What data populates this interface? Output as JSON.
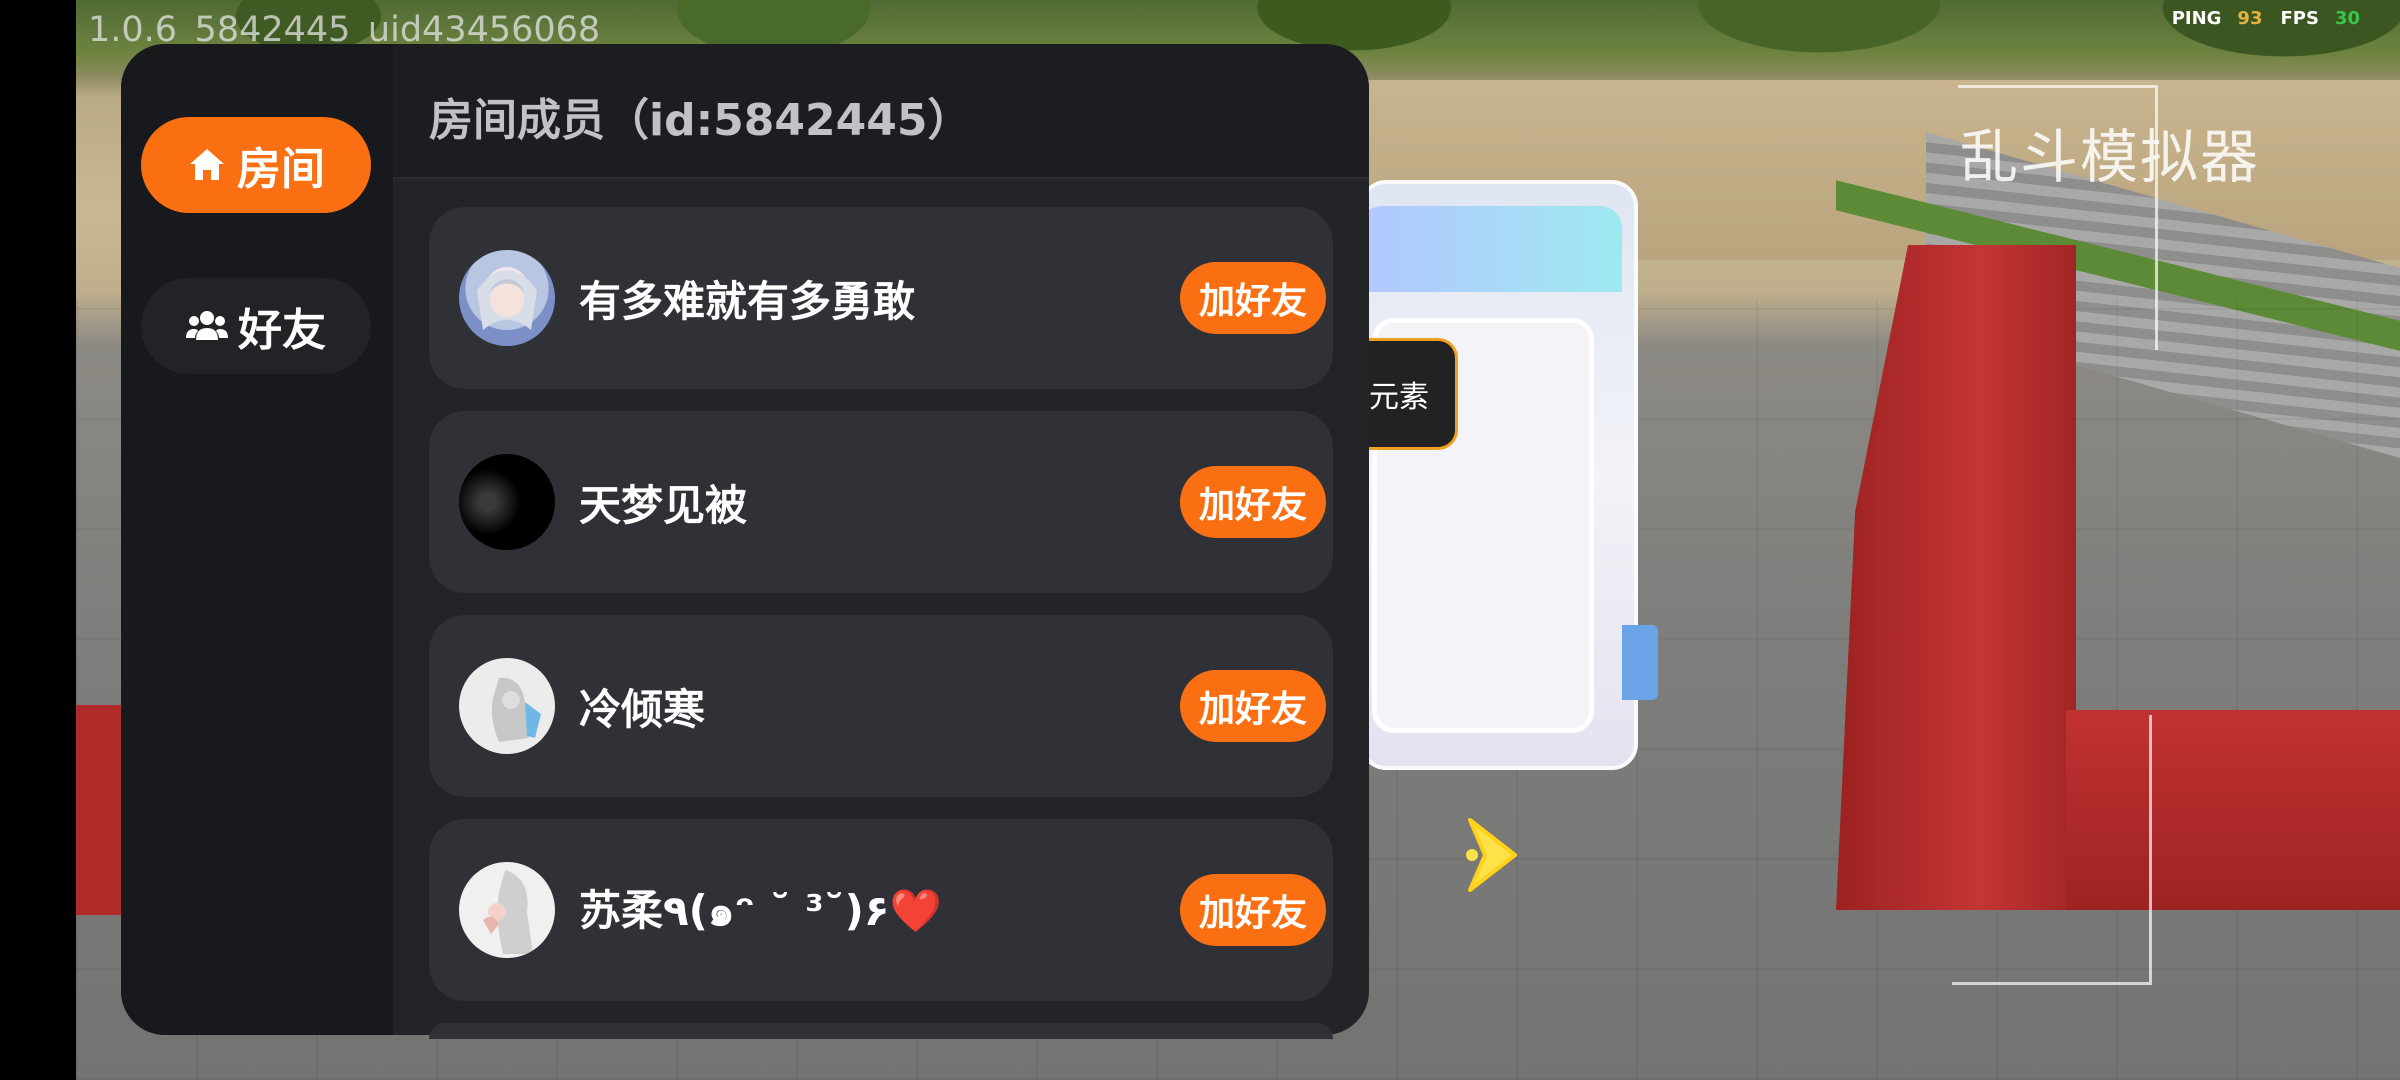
{
  "hud": {
    "version_text": "1.0.6_5842445_uid43456068",
    "ping_label": "PING",
    "ping_value": "93",
    "fps_label": "FPS",
    "fps_value": "30",
    "game_title": "乱斗模拟器"
  },
  "background_dialog": {
    "element_label": "元素"
  },
  "sidebar": {
    "tabs": [
      {
        "label": "房间",
        "icon": "home-icon",
        "active": true
      },
      {
        "label": "好友",
        "icon": "users-icon",
        "active": false
      }
    ]
  },
  "header": {
    "title": "房间成员（id:5842445）"
  },
  "members": [
    {
      "name": "有多难就有多勇敢",
      "avatar": "anime-avatar",
      "action_label": "加好友"
    },
    {
      "name": "天梦见被",
      "avatar": "dark-avatar",
      "action_label": "加好友"
    },
    {
      "name": "冷倾寒",
      "avatar": "sketch-avatar",
      "action_label": "加好友"
    },
    {
      "name": "苏柔٩(๑ᵔ ˘ ³˘)۶❤️",
      "avatar": "silver-hair-avatar",
      "action_label": "加好友"
    }
  ],
  "colors": {
    "accent": "#fa6f12",
    "panel_bg": "#232428",
    "sidebar_bg": "#18191c",
    "card_bg": "#303136"
  }
}
